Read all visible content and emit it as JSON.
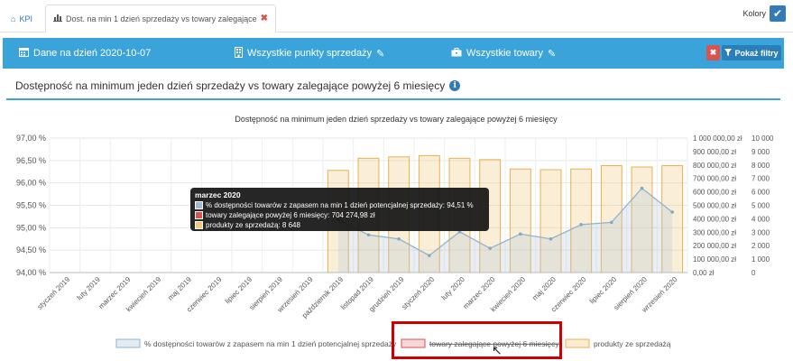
{
  "tabs": [
    {
      "label": "KPI",
      "icon": "home-icon"
    },
    {
      "label": "Dost. na min 1 dzień sprzedaży vs towary zalegające",
      "icon": "bar-chart-icon",
      "active": true
    }
  ],
  "kolory": {
    "label": "Kolory",
    "checked": true
  },
  "filters": {
    "date": "Dane na dzień 2020-10-07",
    "points": "Wszystkie punkty sprzedaży",
    "products": "Wszystkie towary",
    "show_filters": "Pokaż filtry"
  },
  "panel": {
    "title": "Dostępność na minimum jeden dzień sprzedaży vs towary zalegające powyżej 6 miesięcy"
  },
  "chart_data": {
    "type": "bar",
    "title": "Dostępność na minimum jeden dzień sprzedaży vs towary zalegające powyżej 6 miesięcy",
    "categories": [
      "styczeń 2019",
      "luty 2019",
      "marzec 2019",
      "kwiecień 2019",
      "maj 2019",
      "czerwiec 2019",
      "lipiec 2019",
      "sierpień 2019",
      "wrzesień 2019",
      "październik 2019",
      "listopad 2019",
      "grudzień 2019",
      "styczeń 2020",
      "luty 2020",
      "marzec 2020",
      "kwiecień 2020",
      "maj 2020",
      "czerwiec 2020",
      "lipiec 2020",
      "sierpień 2020",
      "wrzesień 2020"
    ],
    "y_left": {
      "ticks": [
        "97,00 %",
        "96,50 %",
        "96,00 %",
        "95,50 %",
        "95,00 %",
        "94,50 %",
        "94,00 %"
      ],
      "range": [
        94,
        97
      ]
    },
    "y_mid": {
      "ticks": [
        "1 000 000,00 zł",
        "900 000,00 zł",
        "800 000,00 zł",
        "700 000,00 zł",
        "600 000,00 zł",
        "500 000,00 zł",
        "400 000,00 zł",
        "300 000,00 zł",
        "200 000,00 zł",
        "100 000,00 zł",
        "0,00 zł"
      ],
      "range": [
        0,
        1000000
      ]
    },
    "y_right": {
      "ticks": [
        "10 000",
        "9 000",
        "8 000",
        "7 000",
        "6 000",
        "5 000",
        "4 000",
        "3 000",
        "2 000",
        "1 000",
        "0"
      ],
      "range": [
        0,
        10000
      ]
    },
    "series": [
      {
        "name": "% dostępności towarów z zapasem na min 1 dzień potencjalnej sprzedaży",
        "type": "area",
        "axis": "left",
        "color": "#7ea9c9",
        "values": [
          null,
          null,
          null,
          null,
          null,
          null,
          null,
          null,
          null,
          95.18,
          94.84,
          94.75,
          94.38,
          94.91,
          94.54,
          94.86,
          94.75,
          95.07,
          95.12,
          95.88,
          95.35
        ]
      },
      {
        "name": "towary zalegające powyżej 6 miesięcy",
        "type": "bar",
        "axis": "mid",
        "color": "#e05a5a",
        "hidden": true,
        "values": [
          null,
          null,
          null,
          null,
          null,
          null,
          null,
          null,
          null,
          null,
          null,
          null,
          null,
          null,
          704274.98,
          null,
          null,
          null,
          null,
          null,
          null
        ]
      },
      {
        "name": "produkty ze sprzedażą",
        "type": "bar",
        "axis": "right",
        "color": "#f3c87a",
        "values": [
          null,
          null,
          null,
          null,
          null,
          null,
          null,
          null,
          null,
          7600,
          8500,
          8600,
          8700,
          8500,
          8400,
          7700,
          7650,
          7700,
          7950,
          7850,
          7950
        ]
      }
    ],
    "legend": [
      "% dostępności towarów z zapasem na min 1 dzień potencjalnej sprzedaży",
      "towary zalegające powyżej 6 miesięcy",
      "produkty ze sprzedażą"
    ],
    "legend_position": "bottom"
  },
  "tooltip": {
    "title": "marzec 2020",
    "line1": "% dostępności towarów z zapasem na min 1 dzień potencjalnej sprzedaży: 94,51 %",
    "line2": "towary zalegające powyżej 6 miesięcy: 704 274,98 zł",
    "line3": "produkty ze sprzedażą: 8 648",
    "colors": [
      "#9fbad0",
      "#d9534f",
      "#f3c87a"
    ]
  }
}
